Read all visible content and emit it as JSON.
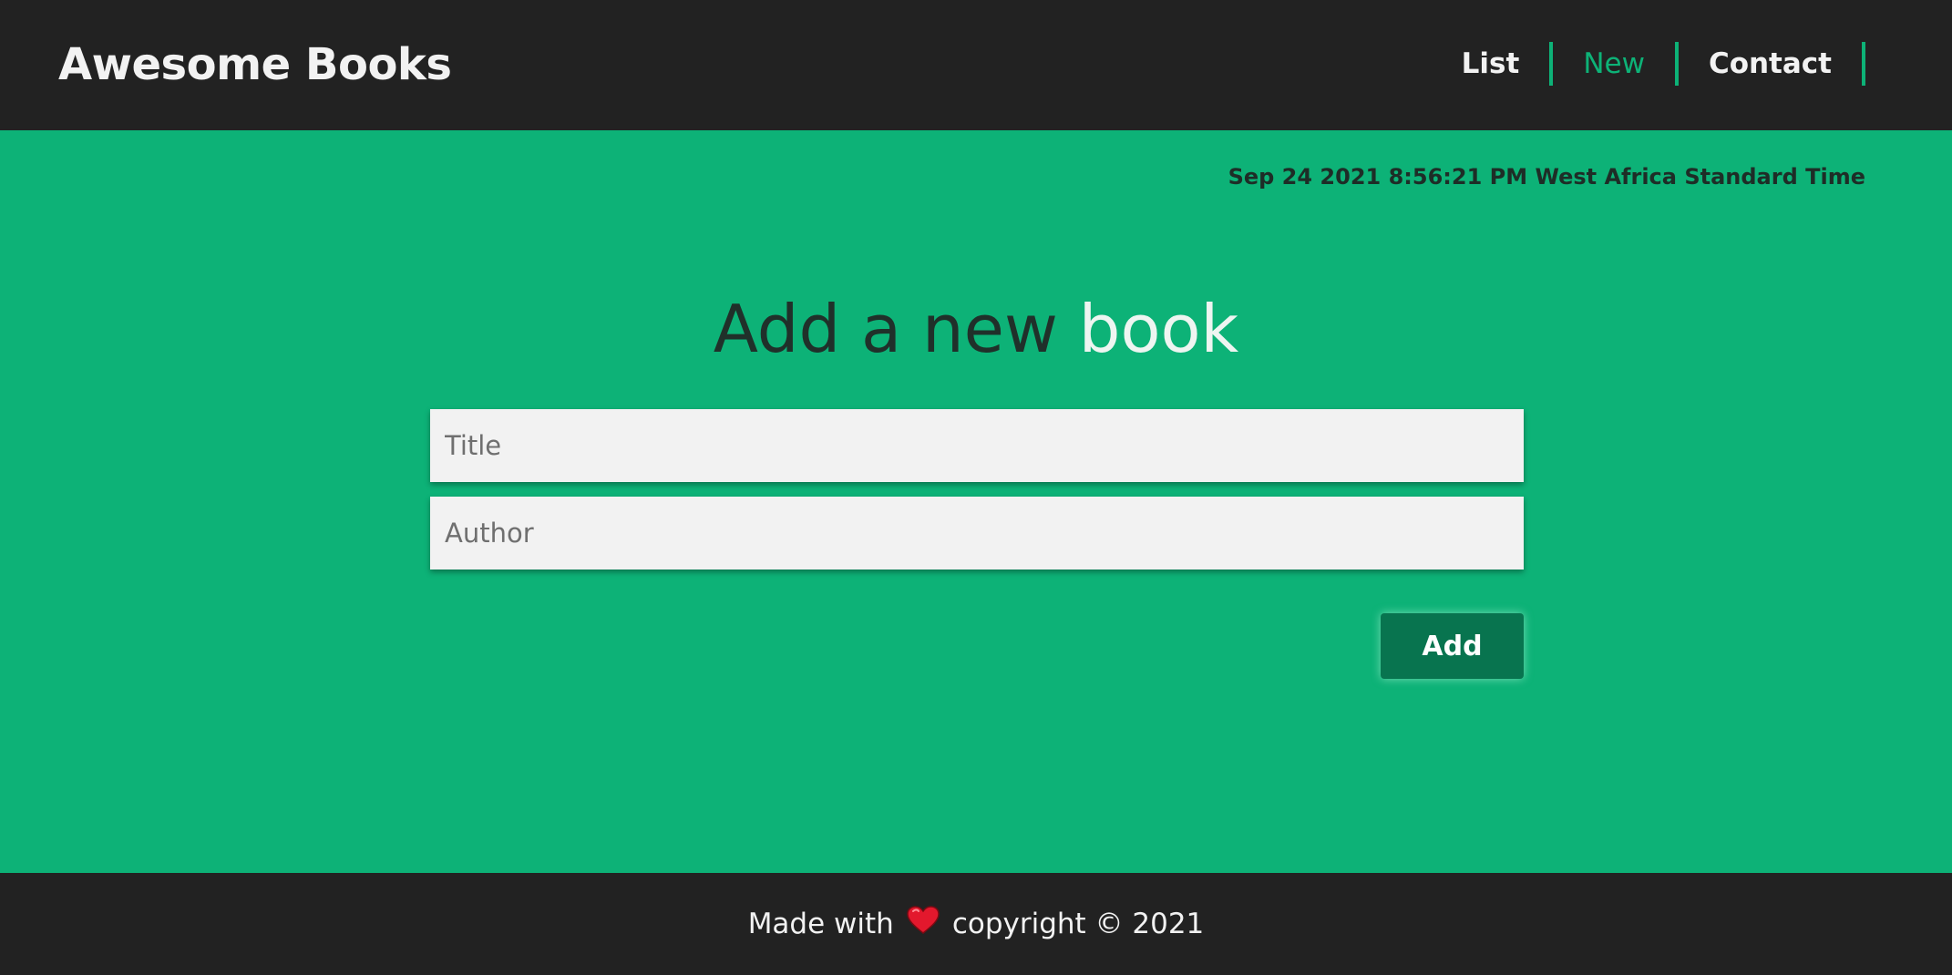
{
  "header": {
    "brand": "Awesome Books",
    "nav": [
      {
        "label": "List",
        "active": false
      },
      {
        "label": "New",
        "active": true
      },
      {
        "label": "Contact",
        "active": false
      }
    ]
  },
  "main": {
    "datetime": "Sep 24 2021 8:56:21 PM West Africa Standard Time",
    "heading_part1": "Add a new ",
    "heading_part2": "book",
    "title_placeholder": "Title",
    "author_placeholder": "Author",
    "add_label": "Add"
  },
  "footer": {
    "made_with": "Made with",
    "heart_icon": "heart-icon",
    "copyright": "copyright © 2021"
  },
  "colors": {
    "accent": "#0db277",
    "header_bg": "#222222",
    "button_bg": "#08744f"
  }
}
